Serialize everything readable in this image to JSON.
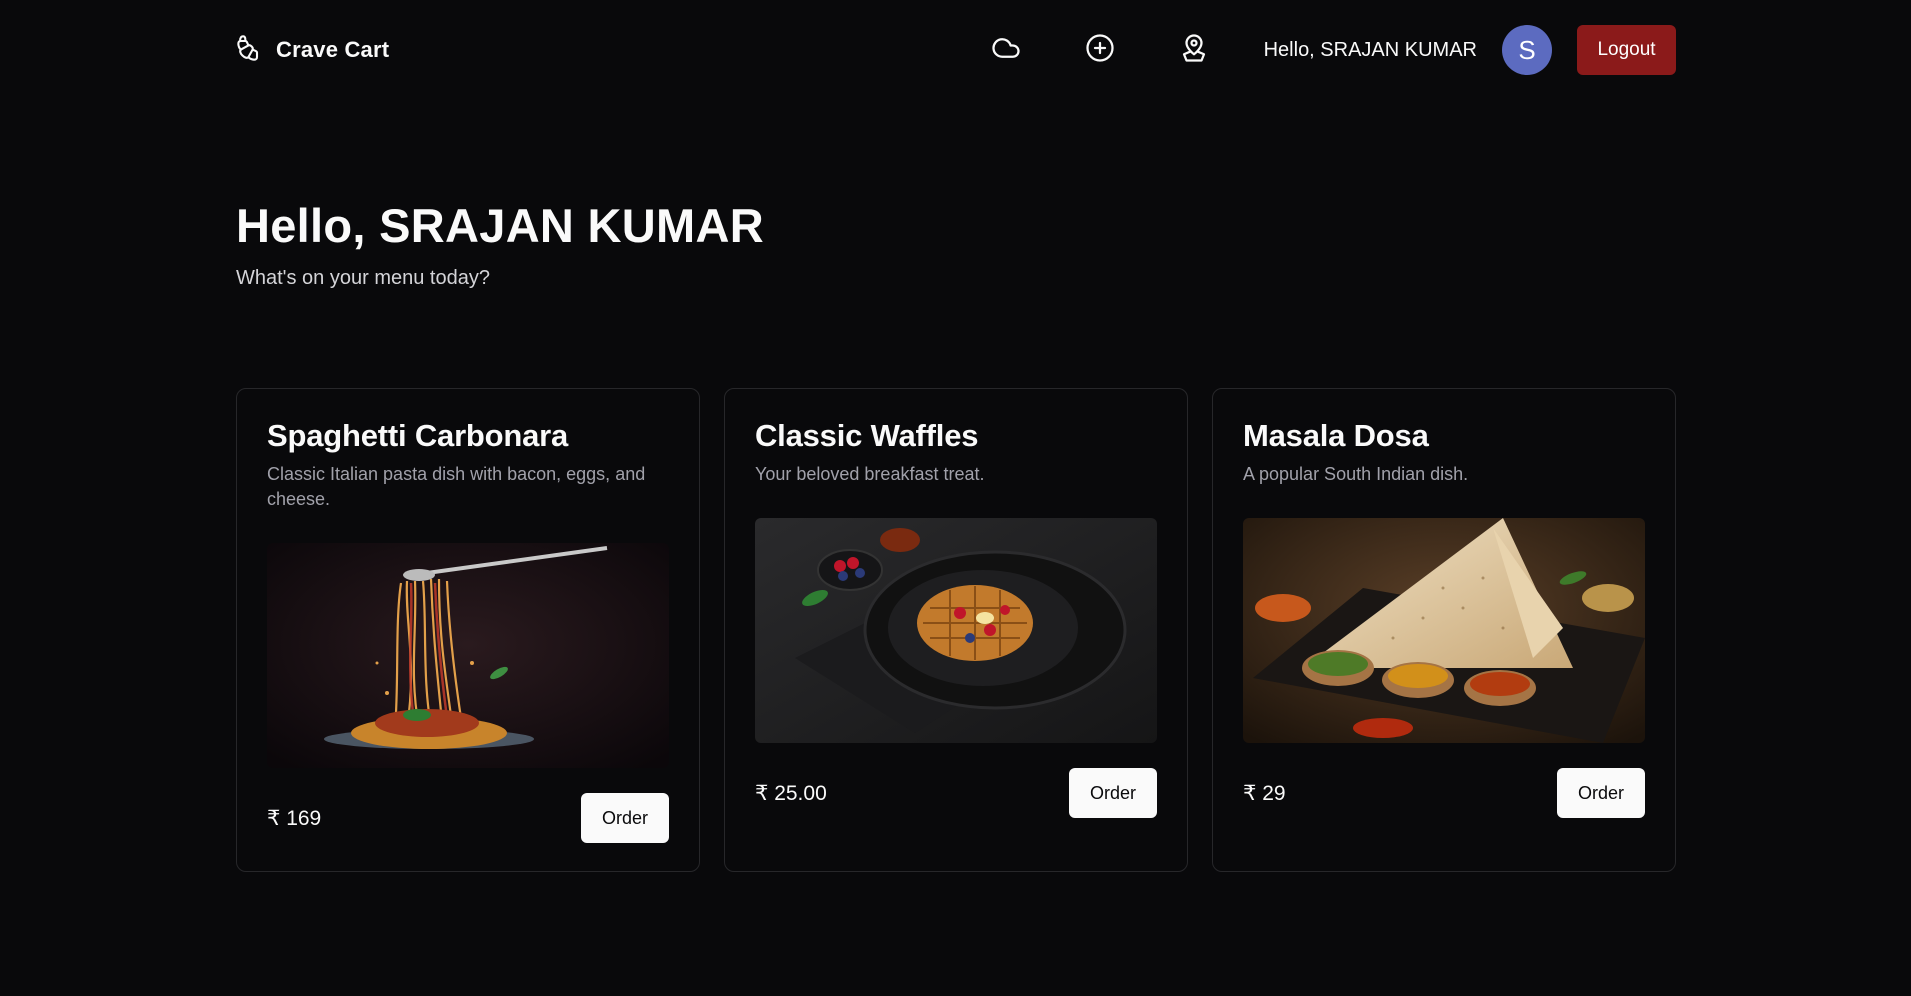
{
  "header": {
    "brand": "Crave Cart",
    "greeting": "Hello, SRAJAN KUMAR",
    "avatar_initial": "S",
    "logout_label": "Logout",
    "icons": [
      "croissant-icon",
      "cloud-icon",
      "plus-circle-icon",
      "map-pin-icon"
    ]
  },
  "hero": {
    "title": "Hello, SRAJAN KUMAR",
    "subtitle": "What's on your menu today?"
  },
  "cards": [
    {
      "title": "Spaghetti Carbonara",
      "description": "Classic Italian pasta dish with bacon, eggs, and cheese.",
      "price": "₹ 169",
      "order_label": "Order"
    },
    {
      "title": "Classic Waffles",
      "description": "Your beloved breakfast treat.",
      "price": "₹ 25.00",
      "order_label": "Order"
    },
    {
      "title": "Masala Dosa",
      "description": "A popular South Indian dish.",
      "price": "₹ 29",
      "order_label": "Order"
    }
  ],
  "colors": {
    "background": "#09090b",
    "logout": "#8b1a1a",
    "avatar": "#5c6bc0",
    "card_border": "#27272a"
  }
}
